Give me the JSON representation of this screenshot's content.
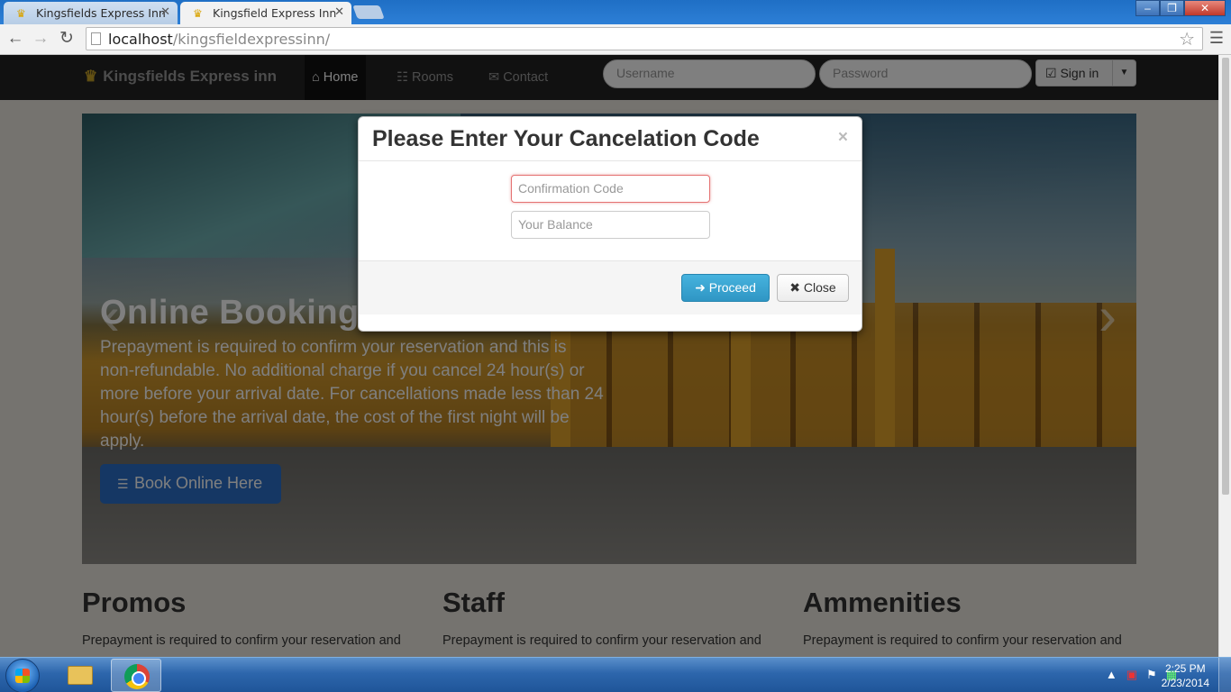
{
  "browser": {
    "tabs": [
      {
        "title": "Kingsfields Express Inn",
        "active": false
      },
      {
        "title": "Kingsfield Express Inn",
        "active": true
      }
    ],
    "url_host": "localhost",
    "url_path": "/kingsfieldexpressinn/"
  },
  "site": {
    "brand": "Kingsfields Express inn",
    "nav": {
      "home": "Home",
      "rooms": "Rooms",
      "contact": "Contact"
    },
    "login": {
      "username_placeholder": "Username",
      "password_placeholder": "Password",
      "signin_label": "Sign in"
    },
    "hero": {
      "heading": "Online Booking",
      "text": "Prepayment is required to confirm your reservation and this is non-refundable. No additional charge if you cancel 24 hour(s) or more before your arrival date. For cancellations made less than 24 hour(s) before the arrival date, the cost of the first night will be apply.",
      "button_label": "Book Online Here"
    },
    "columns": [
      {
        "title": "Promos",
        "text": "Prepayment is required to confirm your reservation and"
      },
      {
        "title": "Staff",
        "text": "Prepayment is required to confirm your reservation and"
      },
      {
        "title": "Ammenities",
        "text": "Prepayment is required to confirm your reservation and"
      }
    ]
  },
  "modal": {
    "title": "Please Enter Your Cancelation Code",
    "close_x": "×",
    "confirmation_placeholder": "Confirmation Code",
    "balance_placeholder": "Your Balance",
    "proceed_label": "Proceed",
    "close_label": "Close"
  },
  "taskbar": {
    "time": "2:25 PM",
    "date": "2/23/2014"
  },
  "colors": {
    "accent_blue": "#2f96c4",
    "invalid_border": "#e57373"
  }
}
